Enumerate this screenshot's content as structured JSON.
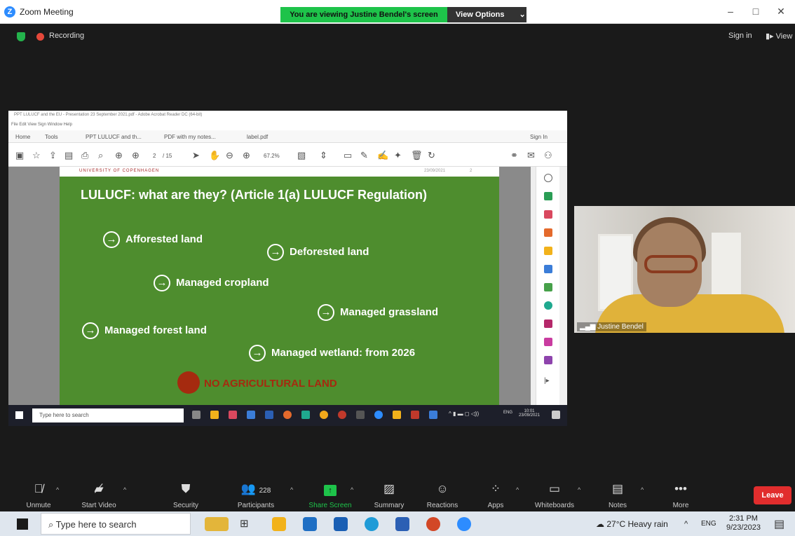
{
  "window": {
    "title": "Zoom Meeting",
    "sharing_banner": "You are viewing Justine Bendel's screen",
    "view_options": "View Options",
    "controls": [
      "–",
      "□",
      "✕"
    ]
  },
  "topbar": {
    "recording": "Recording",
    "sign_in": "Sign in",
    "view": "View"
  },
  "shared_screen": {
    "reader_title": "PPT LULUCF and the EU - Presentation 23 September 2021.pdf - Adobe Acrobat Reader DC (64-bit)",
    "menu": "File  Edit  View  Sign  Window  Help",
    "nav": [
      "Home",
      "Tools"
    ],
    "tabs": [
      "PPT LULUCF and th...",
      "PDF with my notes...",
      "label.pdf"
    ],
    "sign_in": "Sign In",
    "page": "2",
    "page_total": "/ 15",
    "zoom": "67.2%",
    "slide": {
      "university": "UNIVERSITY OF COPENHAGEN",
      "date": "23/09/2021",
      "slide_no": "2",
      "title": "LULUCF: what are they? (Article 1(a) LULUCF Regulation)",
      "items": [
        "Afforested land",
        "Deforested land",
        "Managed cropland",
        "Managed grassland",
        "Managed forest land",
        "Managed wetland: from 2026"
      ],
      "no_ag": "NO AGRICULTURAL LAND"
    },
    "inner_taskbar": {
      "search": "Type here to search",
      "lang": "ENG",
      "time": "10:01",
      "date": "23/09/2021"
    }
  },
  "video": {
    "participant_name": "Justine Bendel"
  },
  "toolbar": {
    "unmute": "Unmute",
    "start_video": "Start Video",
    "security": "Security",
    "participants": "Participants",
    "participant_count": "228",
    "share_screen": "Share Screen",
    "summary": "Summary",
    "reactions": "Reactions",
    "apps": "Apps",
    "whiteboards": "Whiteboards",
    "notes": "Notes",
    "more": "More",
    "leave": "Leave"
  },
  "taskbar": {
    "search": "Type here to search",
    "weather": "27°C  Heavy rain",
    "lang": "ENG",
    "time": "2:31 PM",
    "date": "9/23/2023"
  },
  "colors": {
    "slide_green": "#4e8d2e",
    "share_green": "#1ec34a",
    "leave_red": "#e12d2d",
    "no_ag_red": "#a52a0f"
  }
}
